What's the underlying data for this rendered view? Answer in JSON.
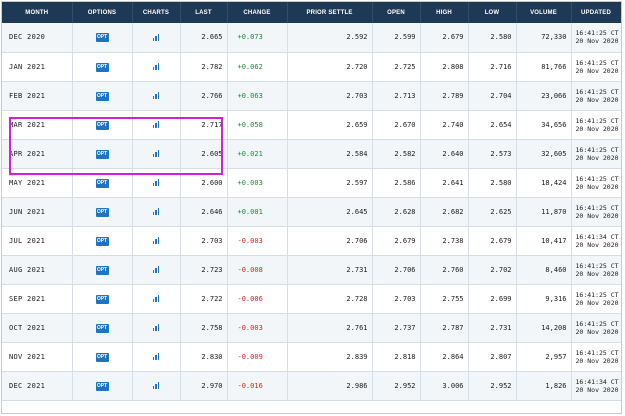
{
  "headers": {
    "month": "MONTH",
    "options": "OPTIONS",
    "charts": "CHARTS",
    "last": "LAST",
    "change": "CHANGE",
    "prior_settle": "PRIOR SETTLE",
    "open": "OPEN",
    "high": "HIGH",
    "low": "LOW",
    "volume": "VOLUME",
    "updated": "UPDATED"
  },
  "opt_label": "OPT",
  "colors": {
    "header_bg": "#1d3956",
    "positive": "#1a8a3a",
    "negative": "#d0241b",
    "button": "#1d74c5",
    "highlight": "#d61fd0"
  },
  "highlighted_rows": [
    "MAR 2021",
    "APR 2021"
  ],
  "rows": [
    {
      "month": "DEC 2020",
      "last": "2.665",
      "change": "+0.073",
      "dir": "pos",
      "prior": "2.592",
      "open": "2.599",
      "high": "2.679",
      "low": "2.580",
      "volume": "72,330",
      "time": "16:41:25 CT",
      "date": "20 Nov 2020"
    },
    {
      "month": "JAN 2021",
      "last": "2.782",
      "change": "+0.062",
      "dir": "pos",
      "prior": "2.720",
      "open": "2.725",
      "high": "2.808",
      "low": "2.716",
      "volume": "81,766",
      "time": "16:41:25 CT",
      "date": "20 Nov 2020"
    },
    {
      "month": "FEB 2021",
      "last": "2.766",
      "change": "+0.063",
      "dir": "pos",
      "prior": "2.703",
      "open": "2.713",
      "high": "2.789",
      "low": "2.704",
      "volume": "23,066",
      "time": "16:41:25 CT",
      "date": "20 Nov 2020"
    },
    {
      "month": "MAR 2021",
      "last": "2.717",
      "change": "+0.058",
      "dir": "pos",
      "prior": "2.659",
      "open": "2.670",
      "high": "2.740",
      "low": "2.654",
      "volume": "34,656",
      "time": "16:41:25 CT",
      "date": "20 Nov 2020"
    },
    {
      "month": "APR 2021",
      "last": "2.605",
      "change": "+0.021",
      "dir": "pos",
      "prior": "2.584",
      "open": "2.582",
      "high": "2.640",
      "low": "2.573",
      "volume": "32,605",
      "time": "16:41:25 CT",
      "date": "20 Nov 2020"
    },
    {
      "month": "MAY 2021",
      "last": "2.600",
      "change": "+0.003",
      "dir": "pos",
      "prior": "2.597",
      "open": "2.586",
      "high": "2.641",
      "low": "2.580",
      "volume": "18,424",
      "time": "16:41:25 CT",
      "date": "20 Nov 2020"
    },
    {
      "month": "JUN 2021",
      "last": "2.646",
      "change": "+0.001",
      "dir": "pos",
      "prior": "2.645",
      "open": "2.628",
      "high": "2.682",
      "low": "2.625",
      "volume": "11,870",
      "time": "16:41:25 CT",
      "date": "20 Nov 2020"
    },
    {
      "month": "JUL 2021",
      "last": "2.703",
      "change": "-0.003",
      "dir": "neg",
      "prior": "2.706",
      "open": "2.679",
      "high": "2.738",
      "low": "2.679",
      "volume": "10,417",
      "time": "16:41:34 CT",
      "date": "20 Nov 2020"
    },
    {
      "month": "AUG 2021",
      "last": "2.723",
      "change": "-0.008",
      "dir": "neg",
      "prior": "2.731",
      "open": "2.706",
      "high": "2.760",
      "low": "2.702",
      "volume": "8,460",
      "time": "16:41:25 CT",
      "date": "20 Nov 2020"
    },
    {
      "month": "SEP 2021",
      "last": "2.722",
      "change": "-0.006",
      "dir": "neg",
      "prior": "2.728",
      "open": "2.703",
      "high": "2.755",
      "low": "2.699",
      "volume": "9,316",
      "time": "16:41:25 CT",
      "date": "20 Nov 2020"
    },
    {
      "month": "OCT 2021",
      "last": "2.758",
      "change": "-0.003",
      "dir": "neg",
      "prior": "2.761",
      "open": "2.737",
      "high": "2.787",
      "low": "2.731",
      "volume": "14,208",
      "time": "16:41:25 CT",
      "date": "20 Nov 2020"
    },
    {
      "month": "NOV 2021",
      "last": "2.830",
      "change": "-0.009",
      "dir": "neg",
      "prior": "2.839",
      "open": "2.818",
      "high": "2.864",
      "low": "2.807",
      "volume": "2,957",
      "time": "16:41:25 CT",
      "date": "20 Nov 2020"
    },
    {
      "month": "DEC 2021",
      "last": "2.970",
      "change": "-0.016",
      "dir": "neg",
      "prior": "2.986",
      "open": "2.952",
      "high": "3.006",
      "low": "2.952",
      "volume": "1,826",
      "time": "16:41:34 CT",
      "date": "20 Nov 2020"
    }
  ]
}
